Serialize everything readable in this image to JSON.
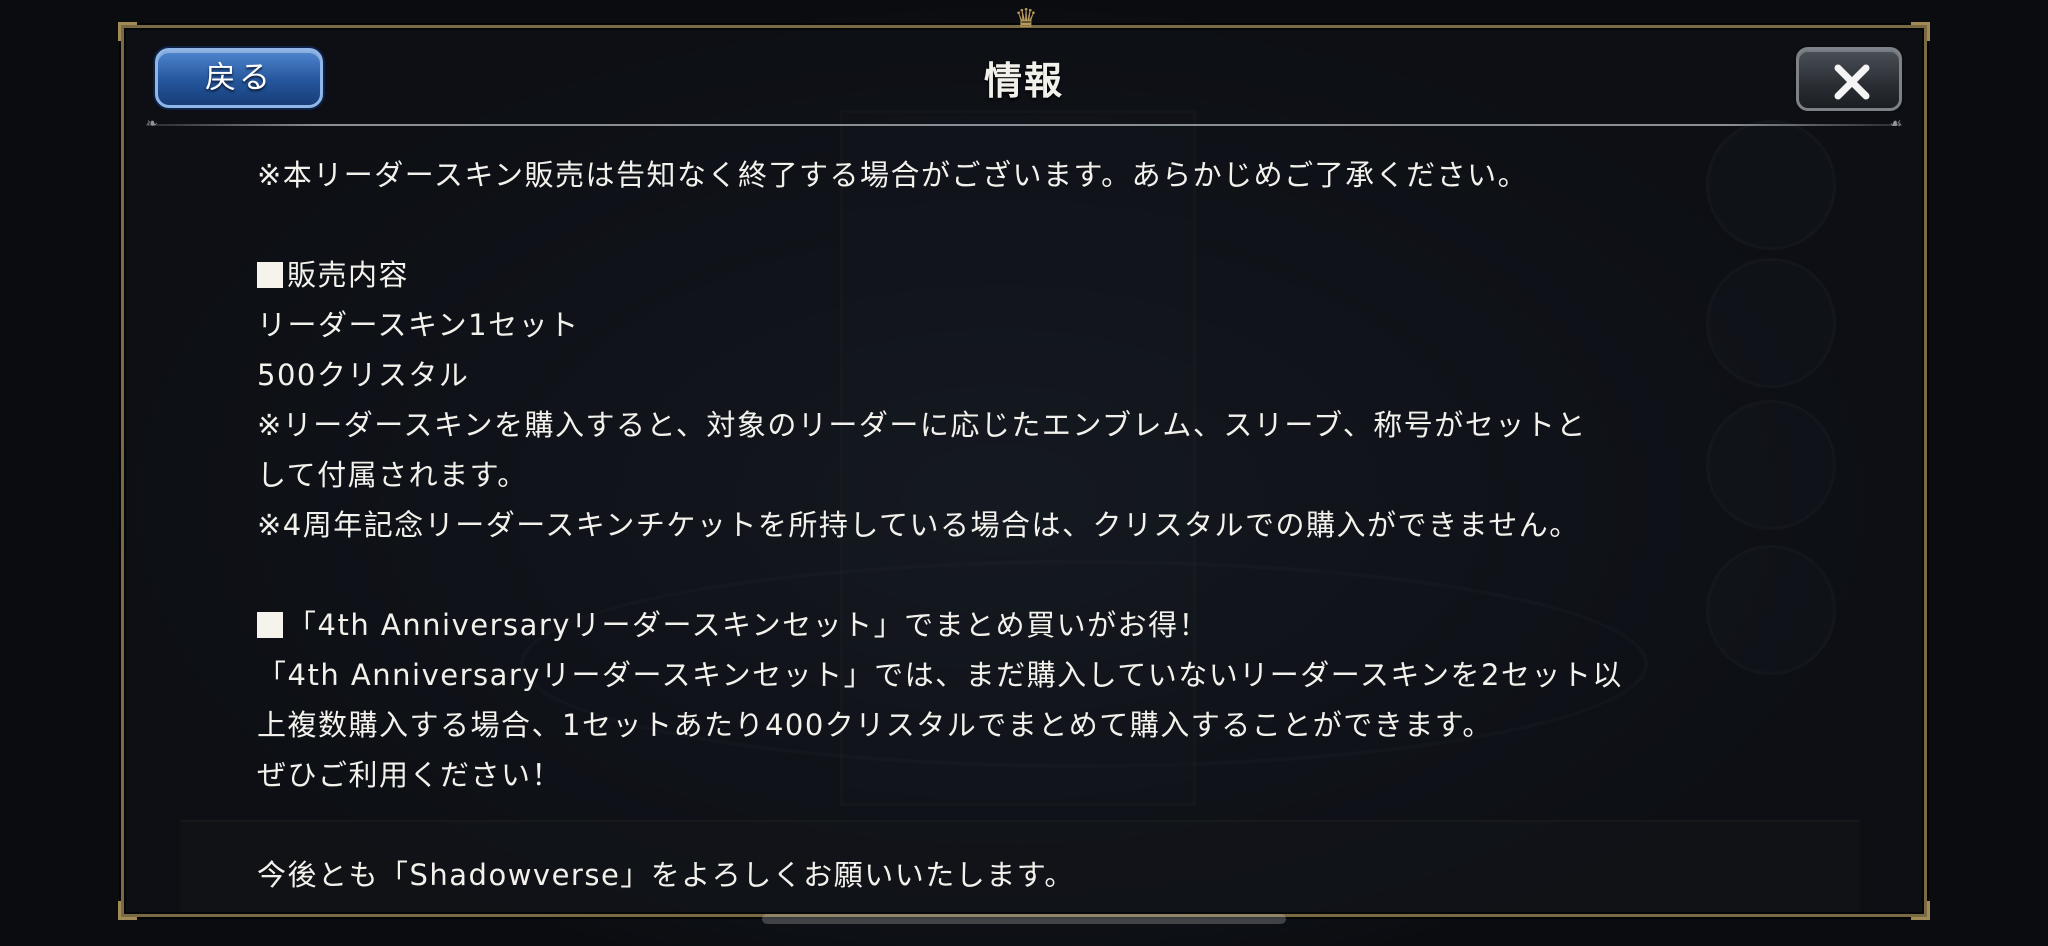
{
  "dialog": {
    "title": "情報",
    "back_label": "戻る"
  },
  "content": {
    "notice": "※本リーダースキン販売は告知なく終了する場合がございます。あらかじめご了承ください。",
    "sale_heading": "販売内容",
    "item_name": "リーダースキン1セット",
    "price": "500クリスタル",
    "note_bundle_1": "※リーダースキンを購入すると、対象のリーダーに応じたエンブレム、スリーブ、称号がセットと",
    "note_bundle_2": "して付属されます。",
    "note_ticket": "※4周年記念リーダースキンチケットを所持している場合は、クリスタルでの購入ができません。",
    "set_heading": "「4th Anniversaryリーダースキンセット」でまとめ買いがお得！",
    "set_desc_1": "「4th Anniversaryリーダースキンセット」では、まだ購入していないリーダースキンを2セット以",
    "set_desc_2": "上複数購入する場合、1セットあたり400クリスタルでまとめて購入することができます。",
    "set_desc_3": "ぜひご利用ください！",
    "closing": "今後とも「Shadowverse」をよろしくお願いいたします。"
  }
}
